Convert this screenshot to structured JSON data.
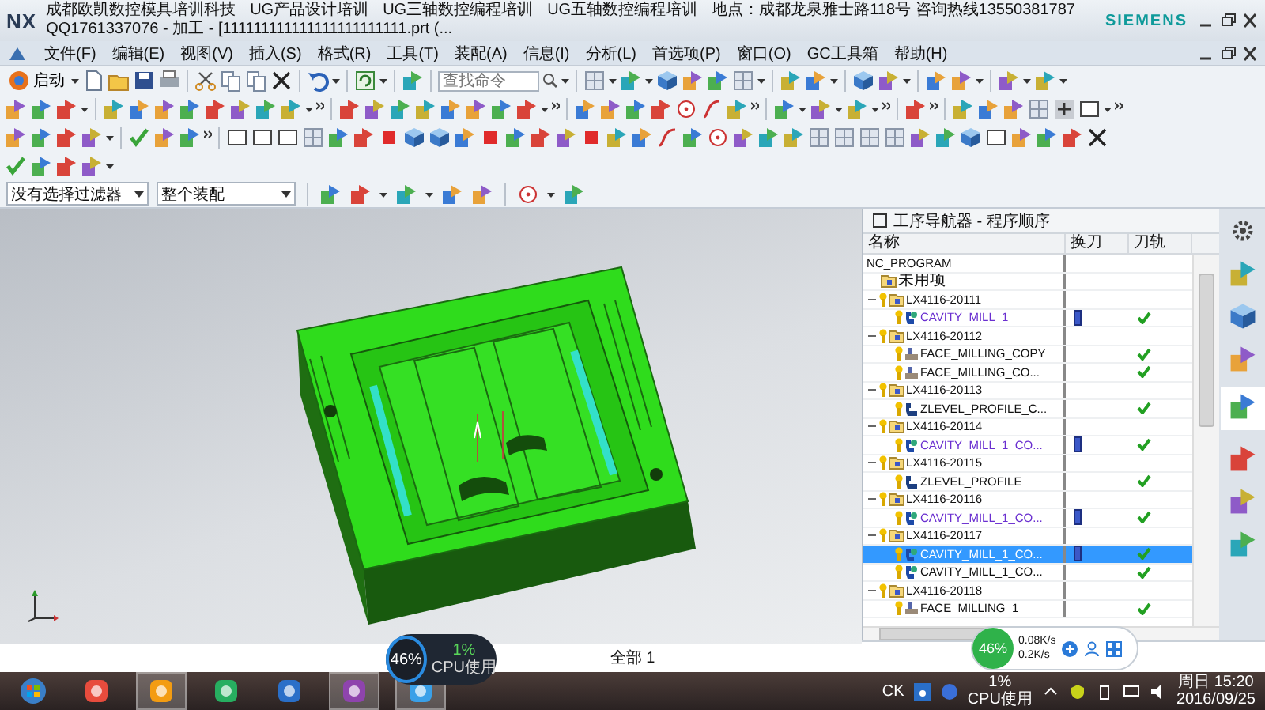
{
  "window": {
    "logo": "NX",
    "title_segments": [
      "成都欧凯数控模具培训科技",
      "UG产品设计培训",
      "UG三轴数控编程培训",
      "UG五轴数控编程培训",
      "地点：成都龙泉雅士路118号 咨询热线13550381787",
      "QQ1761337076 - 加工 - [111111111111111111111111.prt (..."
    ],
    "brand": "SIEMENS"
  },
  "menu": [
    "文件(F)",
    "编辑(E)",
    "视图(V)",
    "插入(S)",
    "格式(R)",
    "工具(T)",
    "装配(A)",
    "信息(I)",
    "分析(L)",
    "首选项(P)",
    "窗口(O)",
    "GC工具箱",
    "帮助(H)"
  ],
  "toolbar": {
    "start_label": "启动",
    "search_placeholder": "查找命令"
  },
  "filters": [
    {
      "value": "没有选择过滤器"
    },
    {
      "value": "整个装配"
    }
  ],
  "navigator": {
    "title": "工序导航器 - 程序顺序",
    "columns": [
      "名称",
      "换刀",
      "刀轨"
    ],
    "tree": {
      "name": "NC_PROGRAM",
      "kind": "root",
      "children": [
        {
          "name": "未用项",
          "kind": "group"
        },
        {
          "name": "LX4116-20111",
          "kind": "program",
          "expanded": true,
          "children": [
            {
              "name": "CAVITY_MILL_1",
              "kind": "cavity",
              "tool_change": true,
              "toolpath": true,
              "selected": false
            }
          ]
        },
        {
          "name": "LX4116-20112",
          "kind": "program",
          "expanded": true,
          "children": [
            {
              "name": "FACE_MILLING_COPY",
              "kind": "face",
              "tool_change": false,
              "toolpath": true,
              "selected": false
            },
            {
              "name": "FACE_MILLING_CO...",
              "kind": "face",
              "tool_change": false,
              "toolpath": true,
              "selected": false
            }
          ]
        },
        {
          "name": "LX4116-20113",
          "kind": "program",
          "expanded": true,
          "children": [
            {
              "name": "ZLEVEL_PROFILE_C...",
              "kind": "zlevel",
              "tool_change": false,
              "toolpath": true,
              "selected": false
            }
          ]
        },
        {
          "name": "LX4116-20114",
          "kind": "program",
          "expanded": true,
          "children": [
            {
              "name": "CAVITY_MILL_1_CO...",
              "kind": "cavity",
              "tool_change": true,
              "toolpath": true,
              "selected": false
            }
          ]
        },
        {
          "name": "LX4116-20115",
          "kind": "program",
          "expanded": true,
          "children": [
            {
              "name": "ZLEVEL_PROFILE",
              "kind": "zlevel",
              "tool_change": false,
              "toolpath": true,
              "selected": false
            }
          ]
        },
        {
          "name": "LX4116-20116",
          "kind": "program",
          "expanded": true,
          "children": [
            {
              "name": "CAVITY_MILL_1_CO...",
              "kind": "cavity",
              "tool_change": true,
              "toolpath": true,
              "selected": false
            }
          ]
        },
        {
          "name": "LX4116-20117",
          "kind": "program",
          "expanded": true,
          "children": [
            {
              "name": "CAVITY_MILL_1_CO...",
              "kind": "cavity",
              "tool_change": true,
              "toolpath": true,
              "selected": true
            },
            {
              "name": "CAVITY_MILL_1_CO...",
              "kind": "cavity",
              "tool_change": false,
              "toolpath": true,
              "selected": false
            }
          ]
        },
        {
          "name": "LX4116-20118",
          "kind": "program",
          "expanded": true,
          "children": [
            {
              "name": "FACE_MILLING_1",
              "kind": "face",
              "tool_change": false,
              "toolpath": true,
              "selected": false
            }
          ]
        }
      ]
    }
  },
  "status_bar": {
    "text": "全部 1"
  },
  "cpu_widget": {
    "gauge": "46%",
    "usage": "1%",
    "label": "CPU使用"
  },
  "net_widget": {
    "gauge": "46%",
    "upload": "0.08K/s",
    "download": "0.2K/s"
  },
  "taskbar": {
    "tray_label": "CK",
    "cpu": "1%",
    "cpu_label": "CPU使用",
    "day_time": "周日 15:20",
    "date": "2016/09/25"
  }
}
